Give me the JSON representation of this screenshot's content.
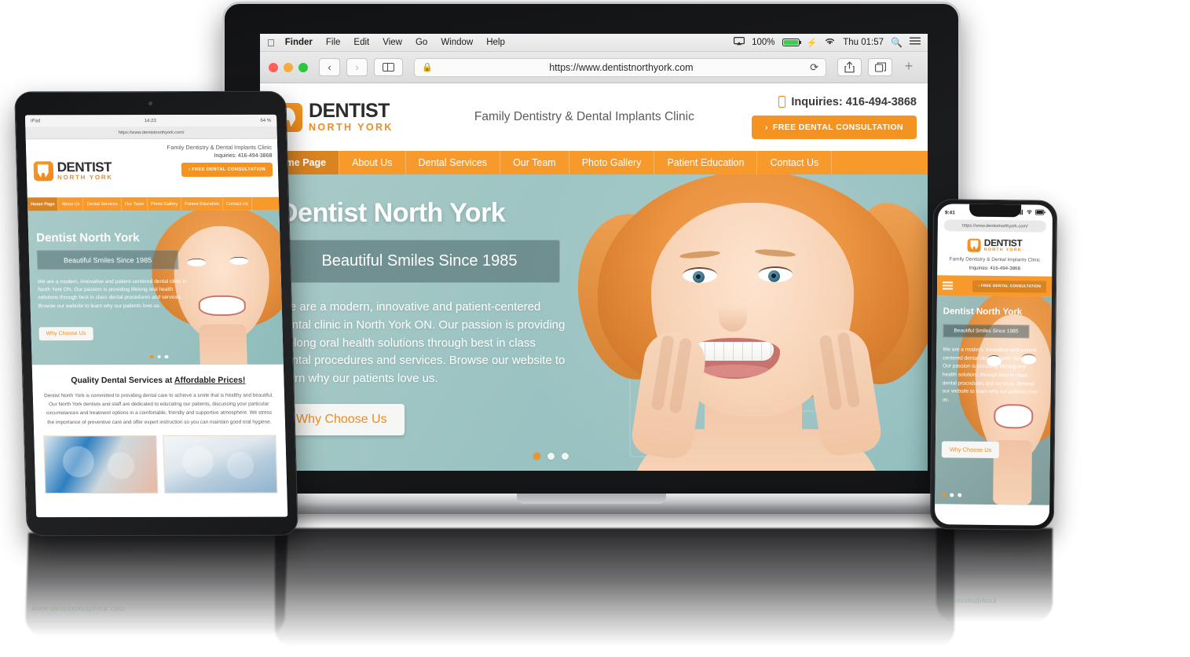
{
  "os": {
    "menubar": {
      "apple_icon": "apple-icon",
      "items": [
        "Finder",
        "File",
        "Edit",
        "View",
        "Go",
        "Window",
        "Help"
      ],
      "airplay_icon": "airplay-icon",
      "battery_percent": "100%",
      "battery_icon": "battery-icon",
      "charging_icon": "charging-bolt-icon",
      "wifi_icon": "wifi-icon",
      "clock": "Thu 01:57",
      "search_icon": "search-icon",
      "notifications_icon": "list-icon"
    },
    "browser": {
      "back_icon": "chevron-left-icon",
      "forward_icon": "chevron-right-icon",
      "sidebar_icon": "sidebar-icon",
      "lock_icon": "lock-icon",
      "url": "https://www.dentistnorthyork.com",
      "reload_icon": "reload-icon",
      "share_icon": "share-icon",
      "tabs_icon": "tabs-icon",
      "new_tab_label": "+"
    }
  },
  "site": {
    "logo": {
      "line1": "DENTIST",
      "line2": "NORTH YORK",
      "icon": "tooth-icon"
    },
    "tagline": "Family Dentistry & Dental Implants Clinic",
    "inquiries_label": "Inquiries:",
    "inquiries_phone": "416-494-3868",
    "phone_icon": "phone-icon",
    "cta_label": "FREE DENTAL CONSULTATION",
    "cta_chevron": "›",
    "nav": [
      {
        "label": "Home Page",
        "active": true
      },
      {
        "label": "About Us",
        "active": false
      },
      {
        "label": "Dental Services",
        "active": false
      },
      {
        "label": "Our Team",
        "active": false
      },
      {
        "label": "Photo Gallery",
        "active": false
      },
      {
        "label": "Patient Education",
        "active": false
      },
      {
        "label": "Contact Us",
        "active": false
      }
    ],
    "hero": {
      "title": "Dentist North York",
      "subtitle": "Beautiful Smiles Since 1985",
      "paragraph": "We are a modern, innovative and patient-centered dental clinic in North York ON. Our passion is providing lifelong oral health solutions through best in class dental procedures and services. Browse our website to learn why our patients love us.",
      "button_label": "Why Choose Us",
      "slides": 3,
      "active_slide": 1
    },
    "section": {
      "heading_plain": "Quality Dental Services at ",
      "heading_underlined": "Affordable Prices!",
      "paragraph": "Dentist North York is committed to providing dental care to achieve a smile that is healthy and beautiful. Our North York dentists and staff are dedicated to educating our patients, discussing your particular circumstances and treatment options in a comfortable, friendly and supportive atmosphere. We stress the importance of preventive care and offer expert instruction so you can maintain good oral hygiene."
    }
  },
  "tablet": {
    "device_label": "iPad",
    "wifi_icon": "wifi-icon",
    "time": "14:23",
    "battery": "64 %",
    "url": "https://www.dentistnorthyork.com/"
  },
  "phone": {
    "time": "9:41",
    "signal_icon": "cellular-icon",
    "wifi_icon": "wifi-icon",
    "battery_icon": "battery-icon",
    "url": "https://www.dentistnorthyork.com/",
    "menu_icon": "hamburger-menu-icon"
  },
  "reflection": {
    "text_1": "www.dentistnorthyork.com",
    "text_2": "dentistnorthyork"
  },
  "colors": {
    "brand_orange": "#f59320",
    "brand_orange_dark": "#d98321",
    "hero_teal": "#9cc4c4",
    "text_dark": "#2c2c2c"
  }
}
